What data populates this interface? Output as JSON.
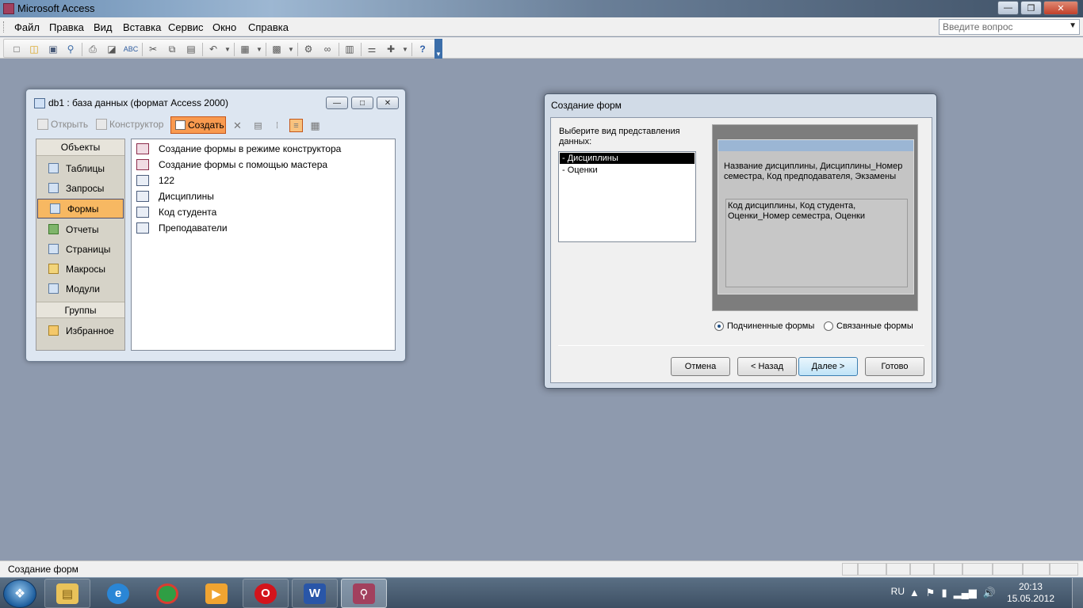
{
  "app": {
    "title": "Microsoft Access"
  },
  "menu": {
    "items": [
      {
        "label": "Файл"
      },
      {
        "label": "Правка"
      },
      {
        "label": "Вид"
      },
      {
        "label": "Вставка"
      },
      {
        "label": "Сервис"
      },
      {
        "label": "Окно"
      },
      {
        "label": "Справка"
      }
    ],
    "help_placeholder": "Введите вопрос"
  },
  "dbwindow": {
    "title": "db1 : база данных (формат Access 2000)",
    "toolbar": {
      "open": "Открыть",
      "design": "Конструктор",
      "create": "Создать"
    },
    "objects_header": "Объекты",
    "objects": [
      {
        "label": "Таблицы"
      },
      {
        "label": "Запросы"
      },
      {
        "label": "Формы",
        "selected": true
      },
      {
        "label": "Отчеты"
      },
      {
        "label": "Страницы"
      },
      {
        "label": "Макросы"
      },
      {
        "label": "Модули"
      }
    ],
    "groups_header": "Группы",
    "groups": [
      {
        "label": "Избранное"
      }
    ],
    "list": [
      {
        "label": "Создание формы в режиме конструктора"
      },
      {
        "label": "Создание формы с помощью мастера"
      },
      {
        "label": "122"
      },
      {
        "label": "Дисциплины"
      },
      {
        "label": "Код студента"
      },
      {
        "label": "Преподаватели"
      }
    ]
  },
  "wizard": {
    "title": "Создание форм",
    "prompt": "Выберите вид представления данных:",
    "views": [
      {
        "label": "- Дисциплины"
      },
      {
        "label": "- Оценки"
      }
    ],
    "preview_main": "Название дисциплины, Дисциплины_Номер семестра, Код предподавателя, Экзамены",
    "preview_sub": "Код дисциплины, Код студента, Оценки_Номер семестра, Оценки",
    "option_subforms": "Подчиненные формы",
    "option_linked": "Связанные формы",
    "btn_cancel": "Отмена",
    "btn_back": "< Назад",
    "btn_next": "Далее >",
    "btn_finish": "Готово"
  },
  "status": {
    "text": "Создание форм"
  },
  "tray": {
    "lang": "RU",
    "time": "20:13",
    "date": "15.05.2012"
  }
}
